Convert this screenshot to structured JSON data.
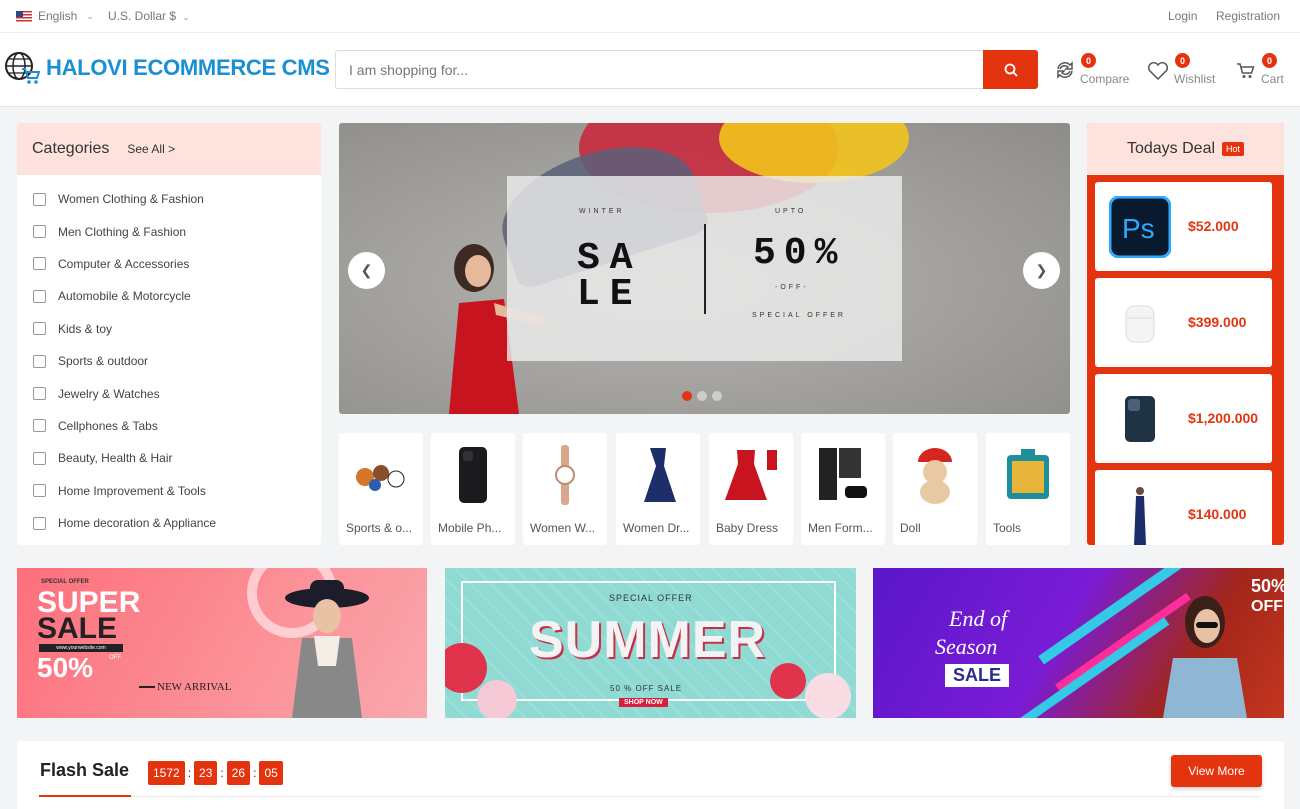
{
  "topbar": {
    "language": "English",
    "currency": "U.S. Dollar $",
    "login": "Login",
    "registration": "Registration"
  },
  "header": {
    "logo_text": "HALOVI ECOMMERCE CMS",
    "search_placeholder": "I am shopping for...",
    "compare": {
      "label": "Compare",
      "count": "0"
    },
    "wishlist": {
      "label": "Wishlist",
      "count": "0"
    },
    "cart": {
      "label": "Cart",
      "count": "0"
    }
  },
  "categories": {
    "title": "Categories",
    "see_all": "See All >",
    "items": [
      {
        "label": "Women Clothing & Fashion"
      },
      {
        "label": "Men Clothing & Fashion"
      },
      {
        "label": "Computer & Accessories"
      },
      {
        "label": "Automobile & Motorcycle"
      },
      {
        "label": "Kids & toy"
      },
      {
        "label": "Sports & outdoor"
      },
      {
        "label": "Jewelry & Watches"
      },
      {
        "label": "Cellphones & Tabs"
      },
      {
        "label": "Beauty, Health & Hair"
      },
      {
        "label": "Home Improvement & Tools"
      },
      {
        "label": "Home decoration & Appliance"
      }
    ]
  },
  "hero": {
    "winter": "WINTER",
    "sale_line1": "SA",
    "sale_line2": "LE",
    "upto": "UPTO",
    "percent": "50%",
    "off": "-OFF-",
    "special": "SPECIAL OFFER",
    "slide_count": 3,
    "active_slide": 1
  },
  "featured": [
    {
      "label": "Sports & o..."
    },
    {
      "label": "Mobile Ph..."
    },
    {
      "label": "Women W..."
    },
    {
      "label": "Women Dr..."
    },
    {
      "label": "Baby Dress"
    },
    {
      "label": "Men Form..."
    },
    {
      "label": "Doll"
    },
    {
      "label": "Tools"
    }
  ],
  "todays_deal": {
    "title": "Todays Deal",
    "badge": "Hot",
    "items": [
      {
        "icon": "photoshop-icon",
        "price": "$52.000"
      },
      {
        "icon": "earbuds-icon",
        "price": "$399.000"
      },
      {
        "icon": "phone-icon",
        "price": "$1,200.000"
      },
      {
        "icon": "dress-icon",
        "price": "$140.000"
      }
    ]
  },
  "banners": {
    "b1": {
      "special": "SPECIAL OFFER",
      "super": "SUPER",
      "sale": "SALE",
      "site": "www.yourwebsite.com",
      "pct": "50%",
      "off": "OFF",
      "new_arrival": "NEW ARRIVAL"
    },
    "b2": {
      "special": "SPECIAL OFFER",
      "summer": "SUMMER",
      "off": "50 % OFF SALE",
      "shop": "SHOP NOW"
    },
    "b3": {
      "end1": "End of",
      "end2": "Season",
      "sale": "SALE",
      "pct": "50%",
      "off": "OFF"
    }
  },
  "flash_sale": {
    "title": "Flash Sale",
    "timer": {
      "days": "1572",
      "hours": "23",
      "minutes": "26",
      "seconds": "05"
    },
    "view_more": "View More"
  },
  "colors": {
    "accent": "#e3340f",
    "logo": "#1a8fd4",
    "header_tint": "#fde2de"
  }
}
